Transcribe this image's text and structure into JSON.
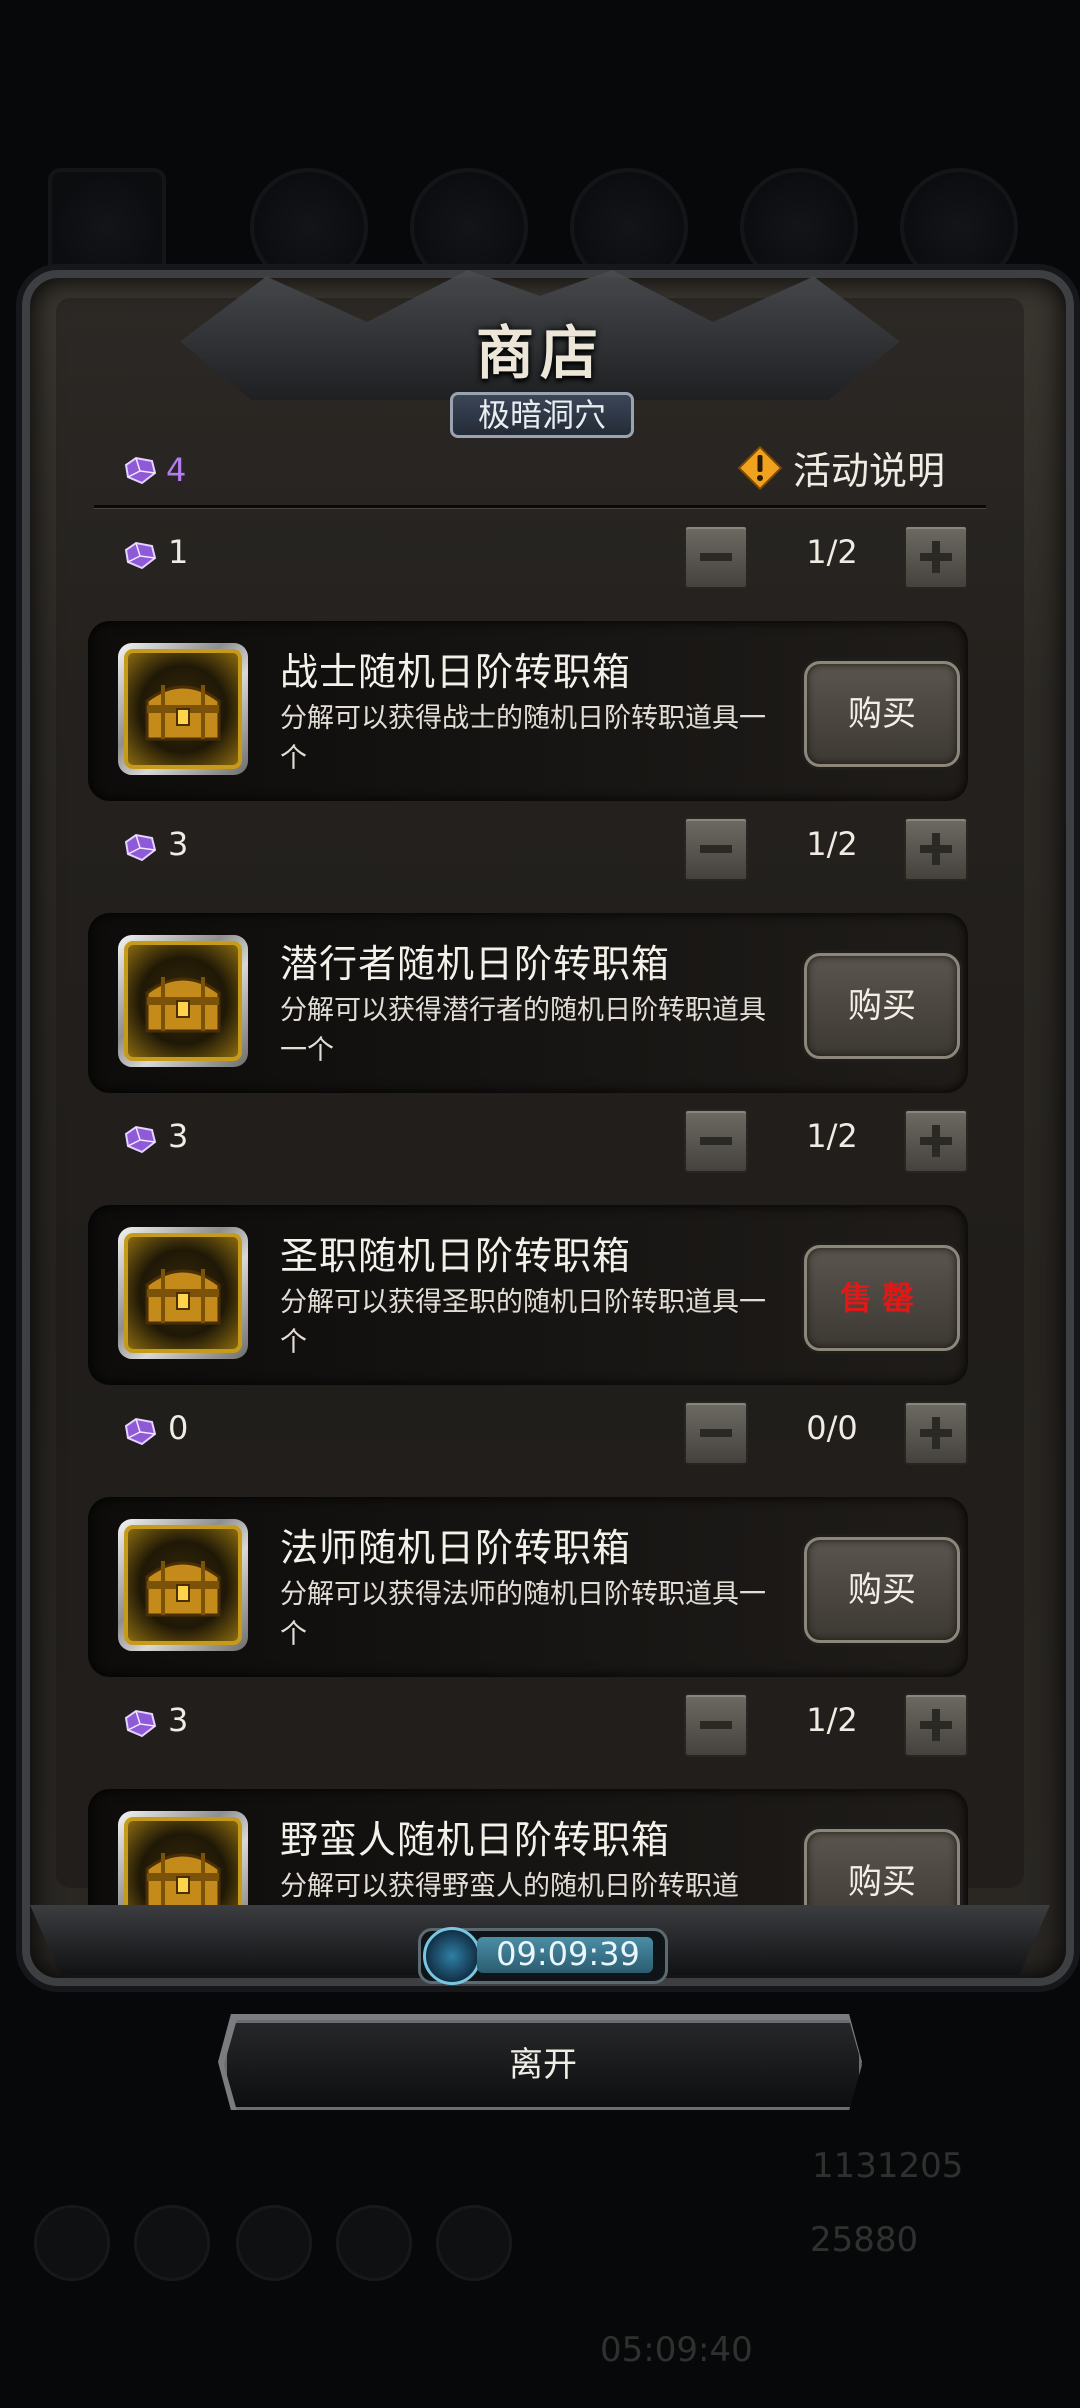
{
  "shop": {
    "title": "商店",
    "subtitle": "极暗洞穴",
    "currency_count": "4",
    "info_label": "活动说明"
  },
  "items": [
    {
      "price": "1",
      "quantity": "1/2",
      "name": "战士随机日阶转职箱",
      "description": "分解可以获得战士的随机日阶转职道具一个",
      "button": "购买"
    },
    {
      "price": "3",
      "quantity": "1/2",
      "name": "潜行者随机日阶转职箱",
      "description": "分解可以获得潜行者的随机日阶转职道具一个",
      "button": "购买"
    },
    {
      "price": "3",
      "quantity": "1/2",
      "name": "圣职随机日阶转职箱",
      "description": "分解可以获得圣职的随机日阶转职道具一个",
      "button": "售罄"
    },
    {
      "price": "0",
      "quantity": "0/0",
      "name": "法师随机日阶转职箱",
      "description": "分解可以获得法师的随机日阶转职道具一个",
      "button": "购买"
    },
    {
      "price": "3",
      "quantity": "1/2",
      "name": "野蛮人随机日阶转职箱",
      "description": "分解可以获得野蛮人的随机日阶转职道",
      "button": "购买"
    }
  ],
  "timer": "09:09:39",
  "leave_label": "离开",
  "background_hud": {
    "gold": "1131205",
    "gems": "25880",
    "timer": "05:09:40"
  },
  "colors": {
    "gem": "#b47cf0",
    "sold_out": "#e01818"
  }
}
